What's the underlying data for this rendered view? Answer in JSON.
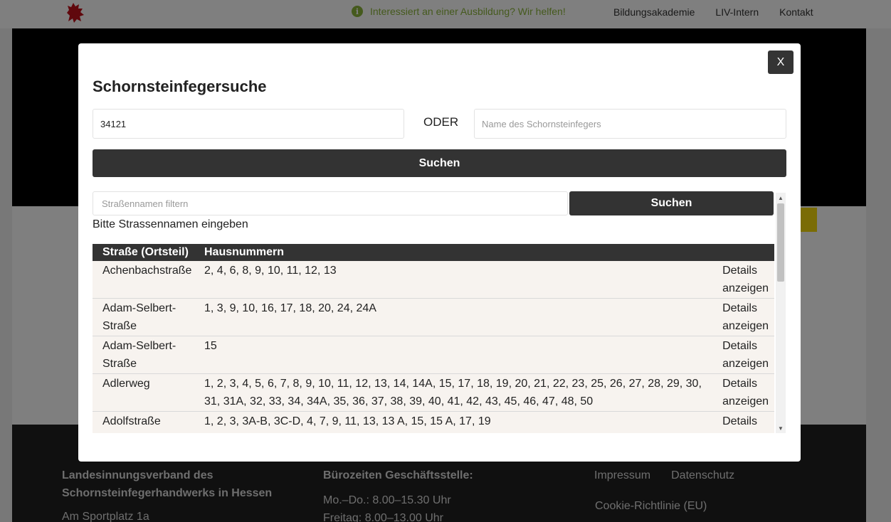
{
  "top_bar": {
    "info_text": "Interessiert an einer Ausbildung? Wir helfen!",
    "nav": [
      "Bildungsakademie",
      "LIV-Intern",
      "Kontakt"
    ]
  },
  "footer": {
    "org_line1": "Landesinnungsverband des",
    "org_line2": "Schornsteinfegerhandwerks in Hessen",
    "address": "Am Sportplatz 1a",
    "hours_title": "Bürozeiten Geschäftsstelle:",
    "hours_line1": "Mo.–Do.: 8.00–15.30 Uhr",
    "hours_line2": "Freitag: 8.00–13.00 Uhr",
    "links": [
      "Impressum",
      "Datenschutz"
    ],
    "cookie": "Cookie-Richtlinie (EU)"
  },
  "modal": {
    "close_label": "X",
    "title": "Schornsteinfegersuche",
    "plz_value": "34121",
    "oder_label": "ODER",
    "name_placeholder": "Name des Schornsteinfegers",
    "search_label": "Suchen",
    "street_filter_placeholder": "Straßennamen filtern",
    "street_search_label": "Suchen",
    "hint": "Bitte Strassennamen eingeben",
    "table": {
      "headers": [
        "Straße (Ortsteil)",
        "Hausnummern"
      ],
      "details_label": "Details anzeigen",
      "rows": [
        {
          "street": "Achenbachstraße",
          "numbers": "2, 4, 6, 8, 9, 10, 11, 12, 13"
        },
        {
          "street": "Adam-Selbert-Straße",
          "numbers": "1, 3, 9, 10, 16, 17, 18, 20, 24, 24A"
        },
        {
          "street": "Adam-Selbert-Straße",
          "numbers": "15"
        },
        {
          "street": "Adlerweg",
          "numbers": "1, 2, 3, 4, 5, 6, 7, 8, 9, 10, 11, 12, 13, 14, 14A, 15, 17, 18, 19, 20, 21, 22, 23, 25, 26, 27, 28, 29, 30, 31, 31A, 32, 33, 34, 34A, 35, 36, 37, 38, 39, 40, 41, 42, 43, 45, 46, 47, 48, 50"
        },
        {
          "street": "Adolfstraße",
          "numbers": "1, 2, 3, 3A-B, 3C-D, 4, 7, 9, 11, 13, 13 A, 15, 15 A, 17, 19"
        }
      ]
    }
  },
  "icons": {
    "logo": "heraldic-lion-logo",
    "info": "info-circle-icon",
    "scroll_up": "scroll-up-arrow-icon",
    "scroll_down": "scroll-down-arrow-icon"
  },
  "colors": {
    "accent_green": "#8bb43a",
    "dark_button": "#333333",
    "logo_red": "#c0101a",
    "accent_yellow": "#f5d90a"
  }
}
